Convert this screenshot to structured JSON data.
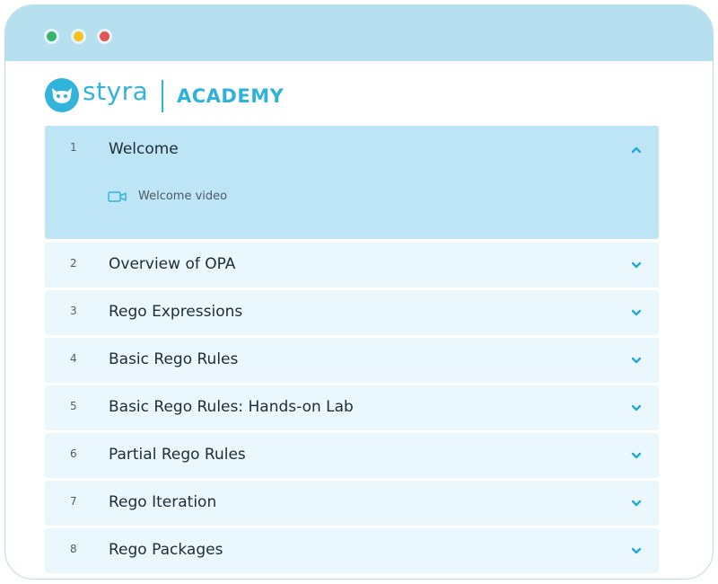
{
  "window": {
    "controls": [
      {
        "name": "green",
        "color": "#38b56a"
      },
      {
        "name": "yellow",
        "color": "#f3c21d"
      },
      {
        "name": "red",
        "color": "#e25552"
      }
    ]
  },
  "header": {
    "brand": "styra",
    "section": "ACADEMY",
    "brand_color": "#32b3d9"
  },
  "modules": [
    {
      "number": "1",
      "title": "Welcome",
      "expanded": true,
      "lessons": [
        {
          "icon": "video-camera-icon",
          "label": "Welcome video"
        }
      ]
    },
    {
      "number": "2",
      "title": "Overview of OPA",
      "expanded": false
    },
    {
      "number": "3",
      "title": "Rego Expressions",
      "expanded": false
    },
    {
      "number": "4",
      "title": "Basic Rego Rules",
      "expanded": false
    },
    {
      "number": "5",
      "title": "Basic Rego Rules: Hands-on Lab",
      "expanded": false
    },
    {
      "number": "6",
      "title": "Partial Rego Rules",
      "expanded": false
    },
    {
      "number": "7",
      "title": "Rego Iteration",
      "expanded": false
    },
    {
      "number": "8",
      "title": "Rego Packages",
      "expanded": false
    }
  ]
}
